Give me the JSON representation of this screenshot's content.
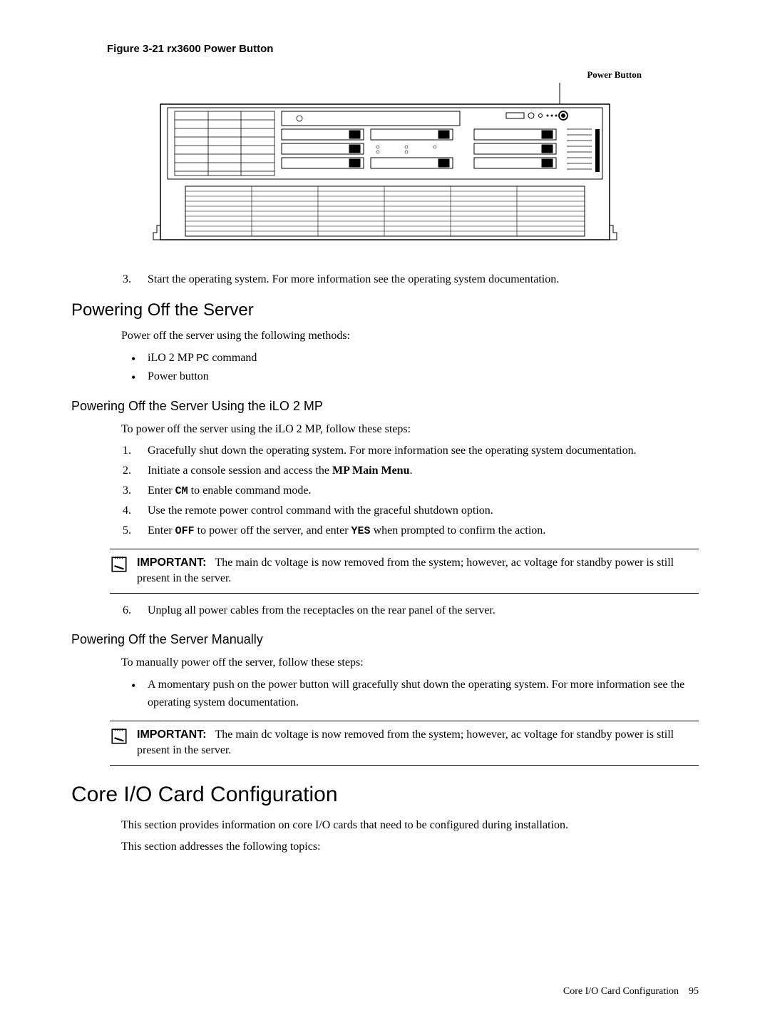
{
  "figure": {
    "caption": "Figure 3-21 rx3600 Power Button",
    "power_label": "Power Button"
  },
  "step3": "Start the operating system. For more information see the operating system documentation.",
  "powering_off": {
    "heading": "Powering Off the Server",
    "intro": "Power off the server using the following methods:",
    "bullets": {
      "b1_prefix": "iLO 2 MP ",
      "b1_mono": "PC",
      "b1_suffix": " command",
      "b2": "Power button"
    }
  },
  "ilo_section": {
    "heading": "Powering Off the Server Using the iLO 2 MP",
    "intro": "To power off the server using the iLO 2 MP, follow these steps:",
    "steps": {
      "s1": "Gracefully shut down the operating system. For more information see the operating system documentation.",
      "s2_pre": "Initiate a console session and access the ",
      "s2_bold": "MP Main Menu",
      "s2_post": ".",
      "s3_pre": "Enter ",
      "s3_mono": "CM",
      "s3_post": " to enable command mode.",
      "s4": "Use the remote power control command with the graceful shutdown option.",
      "s5_pre": "Enter ",
      "s5_mono1": "OFF",
      "s5_mid": " to power off the server, and enter ",
      "s5_mono2": "YES",
      "s5_post": " when prompted to confirm the action.",
      "s6": "Unplug all power cables from the receptacles on the rear panel of the server."
    }
  },
  "important1": {
    "label": "IMPORTANT:",
    "text": "The main dc voltage is now removed from the system; however, ac voltage for standby power is still present in the server."
  },
  "manual_section": {
    "heading": "Powering Off the Server Manually",
    "intro": "To manually power off the server, follow these steps:",
    "bullet": "A momentary push on the power button will gracefully shut down the operating system. For more information see the operating system documentation."
  },
  "important2": {
    "label": "IMPORTANT:",
    "text": "The main dc voltage is now removed from the system; however, ac voltage for standby power is still present in the server."
  },
  "core_io": {
    "heading": "Core I/O Card Configuration",
    "p1": "This section provides information on core I/O cards that need to be configured during installation.",
    "p2": "This section addresses the following topics:"
  },
  "footer": {
    "text": "Core I/O Card Configuration",
    "page": "95"
  }
}
